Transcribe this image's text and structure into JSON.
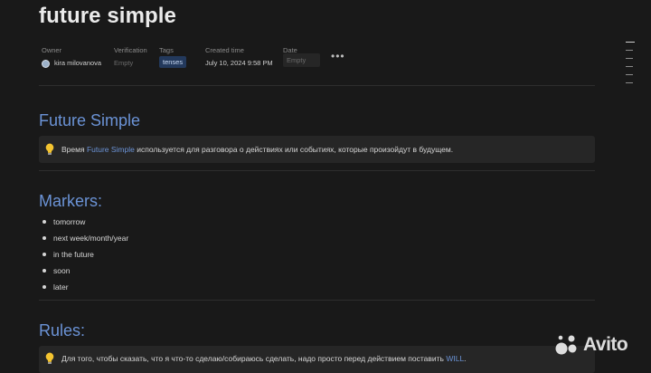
{
  "page": {
    "title": "future simple"
  },
  "properties": {
    "owner": {
      "label": "Owner",
      "value": "kira milovanova"
    },
    "verification": {
      "label": "Verification",
      "value": "Empty"
    },
    "tags": {
      "label": "Tags",
      "value": "tenses"
    },
    "created_time": {
      "label": "Created time",
      "value": "July 10, 2024 9:58 PM"
    },
    "date": {
      "label": "Date",
      "value": "Empty"
    },
    "more_label": "•••"
  },
  "sections": {
    "future_simple": {
      "heading": "Future Simple",
      "callout": {
        "icon": "lightbulb-icon",
        "before": "Время ",
        "link": "Future Simple",
        "after": " используется для разговора о действиях или событиях, которые произойдут в будущем."
      }
    },
    "markers": {
      "heading": "Markers:",
      "items": [
        "tomorrow",
        "next week/month/year",
        "in the future",
        "soon",
        "later"
      ]
    },
    "rules": {
      "heading": "Rules:",
      "callout": {
        "icon": "lightbulb-icon",
        "before": "Для того, чтобы сказать, что я что-то сделаю/собираюсь сделать, надо просто перед действием поставить ",
        "link": "WILL",
        "after": "."
      }
    }
  },
  "watermark": {
    "text": "Avito",
    "icon": "avito-logo-icon"
  },
  "colors": {
    "accent": "#6b93d6",
    "background": "#191919",
    "tag_bg": "#23395c",
    "callout_bg": "#262626"
  }
}
